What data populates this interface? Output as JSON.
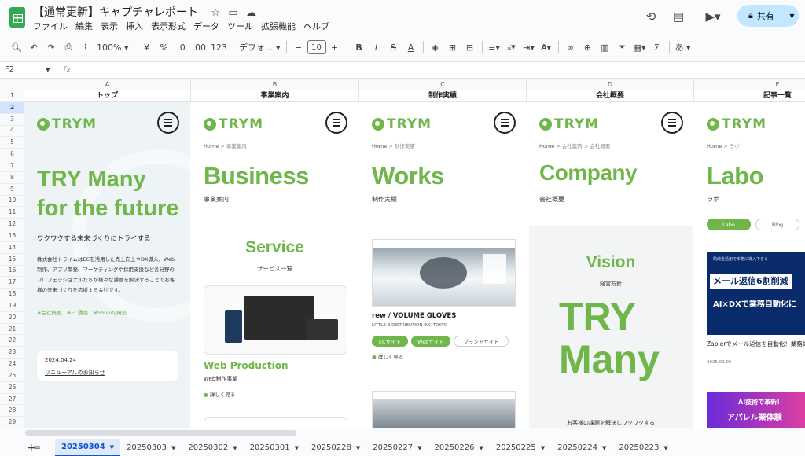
{
  "doc": {
    "title": "【通常更新】キャプチャレポート",
    "share_label": "共有"
  },
  "menu": [
    "ファイル",
    "編集",
    "表示",
    "挿入",
    "表示形式",
    "データ",
    "ツール",
    "拡張機能",
    "ヘルプ"
  ],
  "toolbar": {
    "zoom": "100%",
    "currency": "¥",
    "percent": "%",
    "dec_minus": ".0",
    "dec_plus": ".00",
    "num_format": "123",
    "font": "デフォ...",
    "font_size": "10",
    "ime": "あ"
  },
  "formula": {
    "cell_ref": "F2",
    "fx": "fx"
  },
  "columns": [
    "A",
    "B",
    "C",
    "D",
    "E"
  ],
  "rows": [
    "1",
    "2",
    "3",
    "4",
    "5",
    "6",
    "7",
    "8",
    "9",
    "10",
    "11",
    "12",
    "13",
    "14",
    "15",
    "16",
    "17",
    "18",
    "19",
    "20",
    "21",
    "22",
    "23",
    "24",
    "25",
    "26",
    "27",
    "28",
    "29"
  ],
  "row_selected": "2",
  "column_headers": [
    "トップ",
    "事業案内",
    "制作実績",
    "会社概要",
    "記事一覧"
  ],
  "brand_text": "TRYM",
  "top": {
    "hero_line1": "TRY Many",
    "hero_line2": "for the future",
    "tagline": "ワクワクする未来づくりにトライする",
    "body": "株式会社トライムはECを活用した売上向上やDX導入、Web制作、アプリ開発、マーケティングや採用支援など各分野のプロフェッショナルたちが様々な課題を解決することでお客様の未来づくりを応援する会社です。",
    "tags": "#会社概要　#EC運用　#Shopify構築",
    "news_date": "2024.04.24",
    "news_title": "リニューアルのお知らせ"
  },
  "business": {
    "crumb_home": "Home",
    "crumb_page": "事業案内",
    "title": "Business",
    "subtitle": "事業案内",
    "section": "Service",
    "section_sub": "サービス一覧",
    "card_title": "Web Production",
    "card_sub": "Web制作事業",
    "more": "詳しく見る"
  },
  "works": {
    "crumb_home": "Home",
    "crumb_page": "制作実績",
    "title": "Works",
    "subtitle": "制作実績",
    "item_title": "rew / VOLUME GLOVES",
    "item_client": "LITTLE B DISTRIBUTION INC TOKYO",
    "chip1": "ECサイト",
    "chip2": "Webサイト",
    "chip3": "ブランドサイト",
    "more": "詳しく見る"
  },
  "company": {
    "crumb_home": "Home",
    "crumb_mid": "会社案内",
    "crumb_page": "会社概要",
    "title": "Company",
    "subtitle": "会社概要",
    "vision": "Vision",
    "vision_sub": "経営方針",
    "big1": "TRY",
    "big2": "Many",
    "footer": "お客様の課題を解決しワクワクする"
  },
  "labo": {
    "crumb_home": "Home",
    "crumb_page": "ラボ",
    "title": "Labo",
    "subtitle": "ラボ",
    "chip_on": "Labo",
    "chip_off": "Blog",
    "banner_top": "助成金活用で本格に導入できる",
    "banner_l1": "メール返信6割削減",
    "banner_l2": "AI×DXで業務自動化に",
    "article": "Zapierでメール返信を自動化！業務効率を向上させる方法【実例付き】",
    "article_date": "2025.02.06",
    "banner2_l1": "AI技術で革新！",
    "banner2_l2": "アパレル業体験"
  },
  "sheets": [
    "20250304",
    "20250303",
    "20250302",
    "20250301",
    "20250228",
    "20250227",
    "20250226",
    "20250225",
    "20250224",
    "20250223"
  ],
  "colors": {
    "accent": "#6fb64b",
    "selection": "#0b57d0"
  }
}
